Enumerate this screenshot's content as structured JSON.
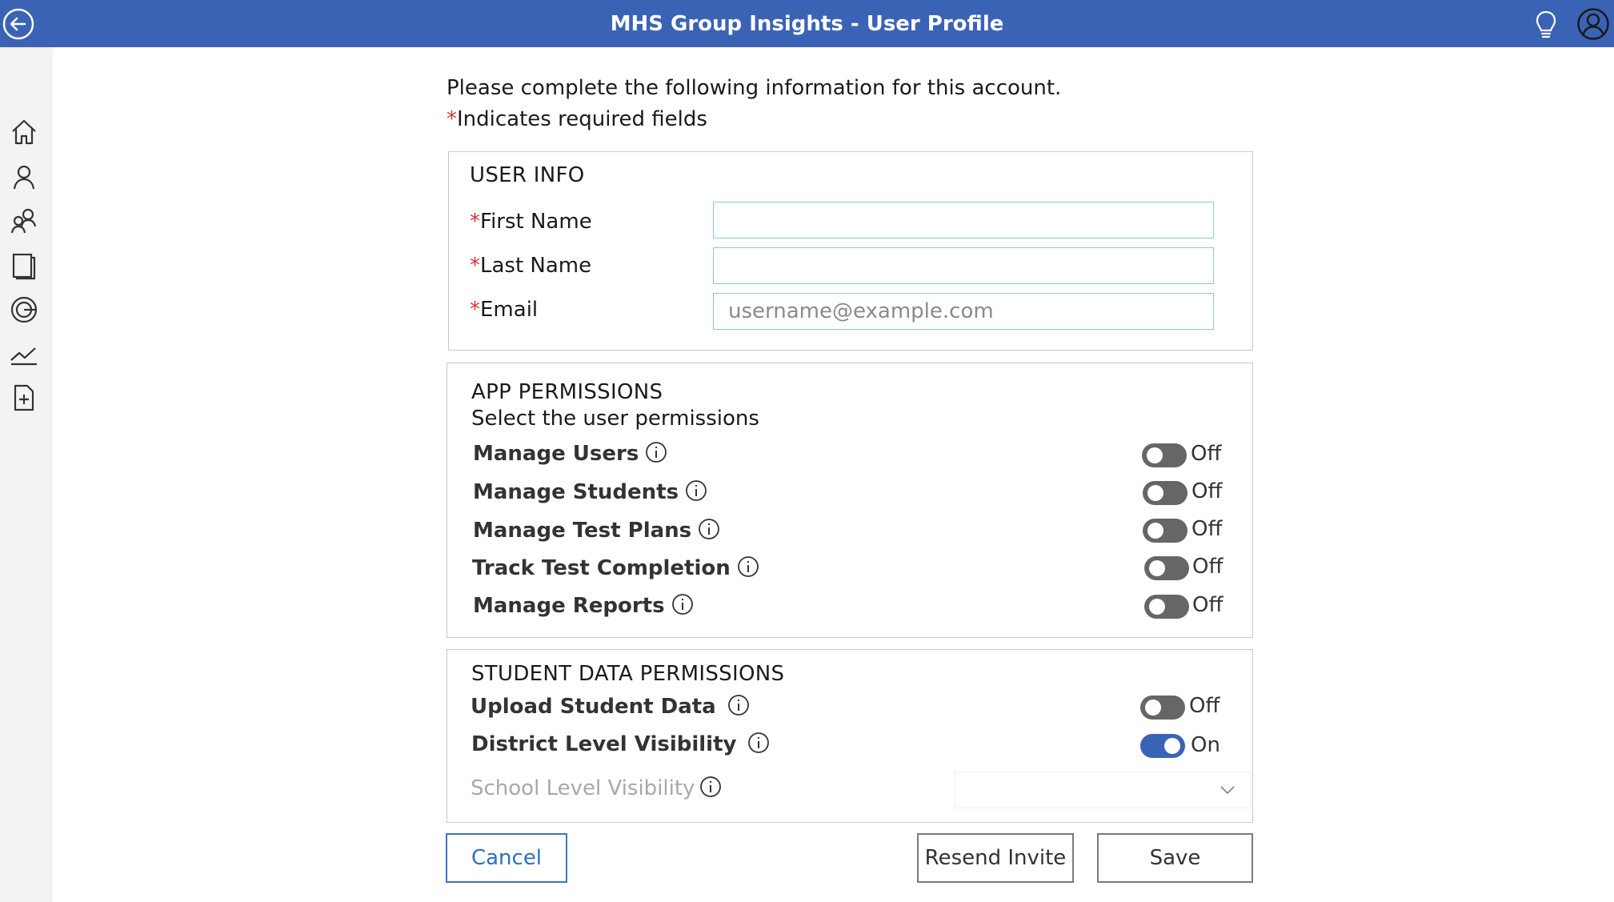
{
  "header": {
    "title": "MHS Group Insights - User Profile"
  },
  "intro": {
    "text": "Please complete the following information for this account.",
    "required_star": "*",
    "required_note": "Indicates required fields"
  },
  "user_info": {
    "title": "USER INFO",
    "fields": [
      {
        "label": "First Name",
        "value": "",
        "placeholder": ""
      },
      {
        "label": "Last Name",
        "value": "",
        "placeholder": ""
      },
      {
        "label": "Email",
        "value": "",
        "placeholder": "username@example.com"
      }
    ]
  },
  "app_permissions": {
    "title": "APP PERMISSIONS",
    "subtitle": "Select the user permissions",
    "items": [
      {
        "label": "Manage Users",
        "state": "Off"
      },
      {
        "label": "Manage Students",
        "state": "Off"
      },
      {
        "label": "Manage Test Plans",
        "state": "Off"
      },
      {
        "label": "Track Test Completion",
        "state": "Off"
      },
      {
        "label": "Manage Reports",
        "state": "Off"
      }
    ]
  },
  "student_permissions": {
    "title": "STUDENT DATA PERMISSIONS",
    "items": [
      {
        "label": "Upload Student Data",
        "state": "Off"
      },
      {
        "label": "District Level Visibility",
        "state": "On"
      }
    ],
    "school_level": {
      "label": "School Level Visibility",
      "selected": ""
    }
  },
  "buttons": {
    "cancel": "Cancel",
    "resend": "Resend Invite",
    "save": "Save"
  },
  "colors": {
    "header_bg": "#3b63b5",
    "toggle_on": "#3b63b5",
    "toggle_off": "#666666",
    "required": "#d13438"
  }
}
